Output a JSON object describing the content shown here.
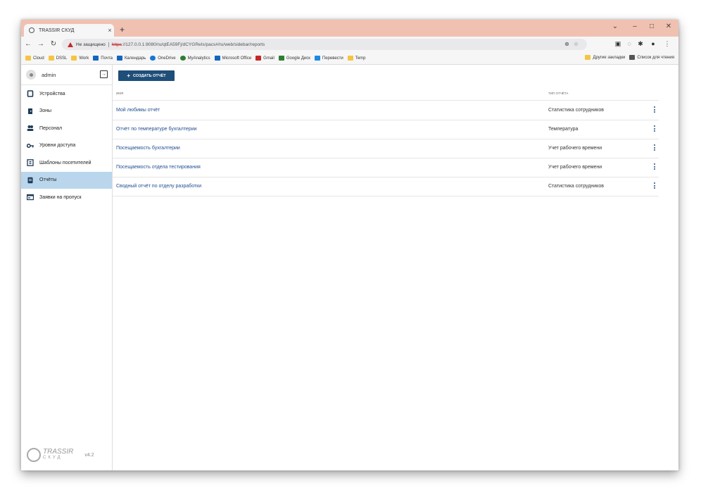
{
  "browser": {
    "tab_title": "TRASSIR СКУД",
    "new_tab": "+",
    "not_secure": "Не защищено",
    "url_scheme": "https",
    "url_rest": "://127.0.0.1:8080/ru/qtEA59Fj/dCYGReIs/pacs#/ru/web/sidebar/reports",
    "bookmarks": [
      {
        "label": "Cloud",
        "color": "#f4c542"
      },
      {
        "label": "DSSL",
        "color": "#f4c542"
      },
      {
        "label": "Work",
        "color": "#f4c542"
      },
      {
        "label": "Почта",
        "color": "#1565c0"
      },
      {
        "label": "Календарь",
        "color": "#1565c0"
      },
      {
        "label": "OneDrive",
        "color": "#1976d2"
      },
      {
        "label": "MyAnalytics",
        "color": "#2e7d32"
      },
      {
        "label": "Microsoft Office",
        "color": "#d84315"
      },
      {
        "label": "Gmail",
        "color": "#c62828"
      },
      {
        "label": "Google Диск",
        "color": "#2e7d32"
      },
      {
        "label": "Перевести",
        "color": "#1e88e5"
      },
      {
        "label": "Temp",
        "color": "#f4c542"
      }
    ],
    "other_bookmarks": "Другие закладки",
    "reading_list": "Список для чтения"
  },
  "sidebar": {
    "user": "admin",
    "items": [
      {
        "label": "Устройства",
        "icon": "devices-icon"
      },
      {
        "label": "Зоны",
        "icon": "zones-icon"
      },
      {
        "label": "Персонал",
        "icon": "people-icon"
      },
      {
        "label": "Уровни доступа",
        "icon": "key-icon"
      },
      {
        "label": "Шаблоны посетителей",
        "icon": "template-icon"
      },
      {
        "label": "Отчёты",
        "icon": "report-icon"
      },
      {
        "label": "Заявки на пропуск",
        "icon": "pass-request-icon"
      }
    ],
    "active_index": 5,
    "logo_main": "TRASSIR",
    "logo_sub": "СКУД",
    "version": "v4.2"
  },
  "main": {
    "create_button": "СОЗДАТЬ ОТЧЁТ",
    "columns": {
      "name": "ИМЯ",
      "type": "ТИП ОТЧЁТА"
    },
    "rows": [
      {
        "name": "Мой любимы отчёт",
        "type": "Статистика сотрудников"
      },
      {
        "name": "Отчёт по температуре бухгалтерии",
        "type": "Температура"
      },
      {
        "name": "Посещаемость бухгалтерии",
        "type": "Учет рабочего времени"
      },
      {
        "name": "Посещаемость отдела тестирования",
        "type": "Учет рабочего времени"
      },
      {
        "name": "Сводный отчёт по отделу разработки",
        "type": "Статистика сотрудников"
      }
    ]
  },
  "colors": {
    "accent": "#1f4e79",
    "active_nav": "#b9d6ec",
    "tabstrip": "#f0c1b0",
    "link": "#1f4e8f"
  }
}
